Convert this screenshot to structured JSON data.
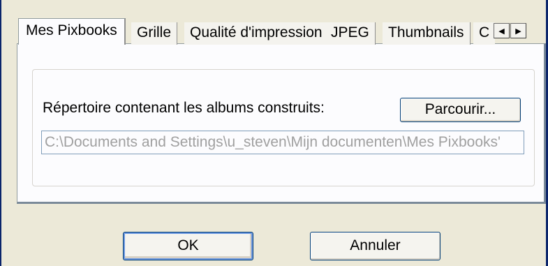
{
  "tabs": [
    {
      "label": "Mes Pixbooks"
    },
    {
      "label": "Grille"
    },
    {
      "label": "Qualité d'impression"
    },
    {
      "label": "JPEG"
    },
    {
      "label": "Thumbnails"
    },
    {
      "label": "C"
    }
  ],
  "tab_scroll": {
    "left_icon": "triangle-left-icon",
    "right_icon": "triangle-right-icon",
    "left_glyph": "◀",
    "right_glyph": "▶"
  },
  "main": {
    "directory_label": "Répertoire contenant les albums construits:",
    "browse_button": "Parcourir...",
    "path_value": "C:\\Documents and Settings\\u_steven\\Mijn documenten\\Mes Pixbooks'"
  },
  "footer": {
    "ok_label": "OK",
    "cancel_label": "Annuler"
  }
}
